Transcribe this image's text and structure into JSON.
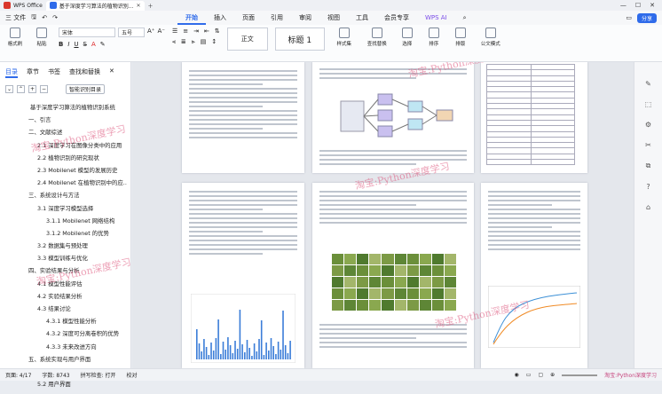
{
  "titlebar": {
    "tabs": [
      {
        "label": "WPS Office",
        "color": "#d9362b"
      },
      {
        "label": "基于深度学习算法的植物识别...",
        "color": "#2f6bea"
      }
    ]
  },
  "menubar": {
    "file": "三 文件",
    "items": [
      "开始",
      "插入",
      "页面",
      "引用",
      "审阅",
      "视图",
      "工具",
      "会员专享"
    ],
    "active": "开始",
    "wps_ai": "WPS AI",
    "share": "分享"
  },
  "ribbon": {
    "format_painter": "格式刷",
    "paste": "粘贴",
    "font_name": "宋体",
    "font_size": "五号",
    "style_normal": "正文",
    "style_heading1": "标题 1",
    "styles": "样式集",
    "find_replace": "查找替换",
    "select": "选择",
    "sort": "排序",
    "layout": "排版",
    "doc_check": "公文模式"
  },
  "sidebar": {
    "tabs": [
      "目录",
      "章节",
      "书签",
      "查找和替换"
    ],
    "active_tab": "目录",
    "smart_toc": "智能识别目录",
    "toc": [
      {
        "level": 0,
        "text": "基于深度学习算法的植物识别系统"
      },
      {
        "level": 1,
        "text": "一、引言"
      },
      {
        "level": 1,
        "text": "二、文献综述"
      },
      {
        "level": 2,
        "text": "2.1 深度学习在图像分类中的应用"
      },
      {
        "level": 2,
        "text": "2.2 植物识别的研究现状"
      },
      {
        "level": 2,
        "text": "2.3 Mobilenet 模型的发展历史"
      },
      {
        "level": 2,
        "text": "2.4 Mobilenet 在植物识别中的应..."
      },
      {
        "level": 1,
        "text": "三、系统设计与方法"
      },
      {
        "level": 2,
        "text": "3.1 深度学习模型选择"
      },
      {
        "level": 3,
        "text": "3.1.1 Mobilenet 网络结构"
      },
      {
        "level": 3,
        "text": "3.1.2 Mobilenet 的优势"
      },
      {
        "level": 2,
        "text": "3.2 数据集与预处理"
      },
      {
        "level": 2,
        "text": "3.3 模型训练与优化"
      },
      {
        "level": 1,
        "text": "四、实验结果与分析"
      },
      {
        "level": 2,
        "text": "4.1 模型性能评估"
      },
      {
        "level": 2,
        "text": "4.2 实验结果分析"
      },
      {
        "level": 2,
        "text": "4.3 结果讨论"
      },
      {
        "level": 3,
        "text": "4.3.1 模型性能分析"
      },
      {
        "level": 3,
        "text": "4.3.2 深度可分离卷积的优势"
      },
      {
        "level": 3,
        "text": "4.3.3 未来改进方向"
      },
      {
        "level": 1,
        "text": "五、系统实现与用户界面"
      },
      {
        "level": 2,
        "text": "5.1 系统架构"
      },
      {
        "level": 2,
        "text": "5.2 用户界面"
      }
    ]
  },
  "watermarks": [
    "淘宝:Python深度学习",
    "淘宝:Python深度学习",
    "淘宝:Python深度学习",
    "淘宝:Python深度学习",
    "淘宝:Python深度学习"
  ],
  "status": {
    "page": "页面: 4/17",
    "words": "字数: 8743",
    "spell": "拼写检查: 打开",
    "proof": "校对",
    "zoom_watermark": "淘宝:Python深度学习"
  }
}
